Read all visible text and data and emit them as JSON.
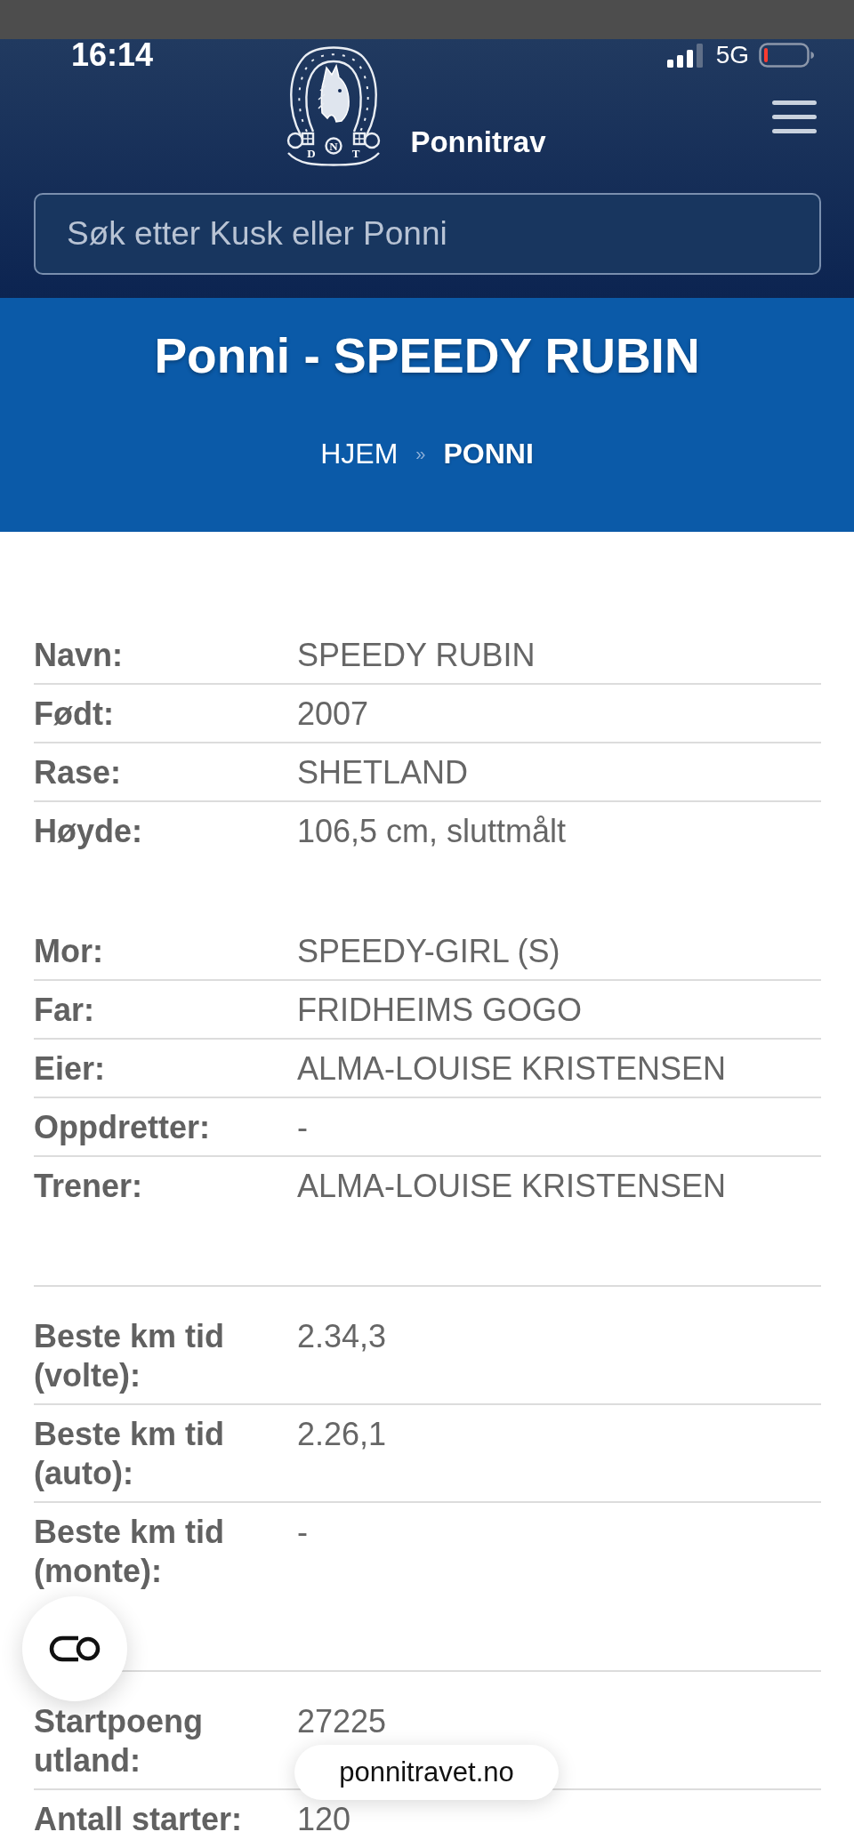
{
  "status_bar": {
    "time": "16:14",
    "network": "5G"
  },
  "header": {
    "logo_letters": [
      "D",
      "N",
      "T"
    ],
    "site_name": "Ponnitrav",
    "search": {
      "placeholder": "Søk etter Kusk eller Ponni"
    }
  },
  "hero": {
    "title": "Ponni - SPEEDY RUBIN",
    "separator": "»",
    "breadcrumb": [
      {
        "label": "HJEM",
        "current": false
      },
      {
        "label": "PONNI",
        "current": true
      }
    ]
  },
  "details": [
    {
      "rows": [
        {
          "label": "Navn:",
          "value": "SPEEDY RUBIN"
        },
        {
          "label": "Født:",
          "value": "2007"
        },
        {
          "label": "Rase:",
          "value": "SHETLAND"
        },
        {
          "label": "Høyde:",
          "value": "106,5 cm, sluttmålt"
        }
      ]
    },
    {
      "rows": [
        {
          "label": "Mor:",
          "value": "SPEEDY-GIRL (S)"
        },
        {
          "label": "Far:",
          "value": "FRIDHEIMS GOGO"
        },
        {
          "label": "Eier:",
          "value": "ALMA-LOUISE KRISTENSEN"
        },
        {
          "label": "Oppdretter:",
          "value": "-"
        },
        {
          "label": "Trener:",
          "value": "ALMA-LOUISE KRISTENSEN"
        }
      ]
    },
    {
      "rows": [
        {
          "label": "Beste km tid (volte):",
          "value": "2.34,3"
        },
        {
          "label": "Beste km tid (auto):",
          "value": "2.26,1"
        },
        {
          "label": "Beste km tid (monte):",
          "value": "-"
        }
      ]
    },
    {
      "rows": [
        {
          "label": "Startpoeng utland:",
          "value": "27225"
        },
        {
          "label": "Antall starter:",
          "value": "120"
        }
      ]
    }
  ],
  "browser": {
    "address": "ponnitravet.no"
  }
}
